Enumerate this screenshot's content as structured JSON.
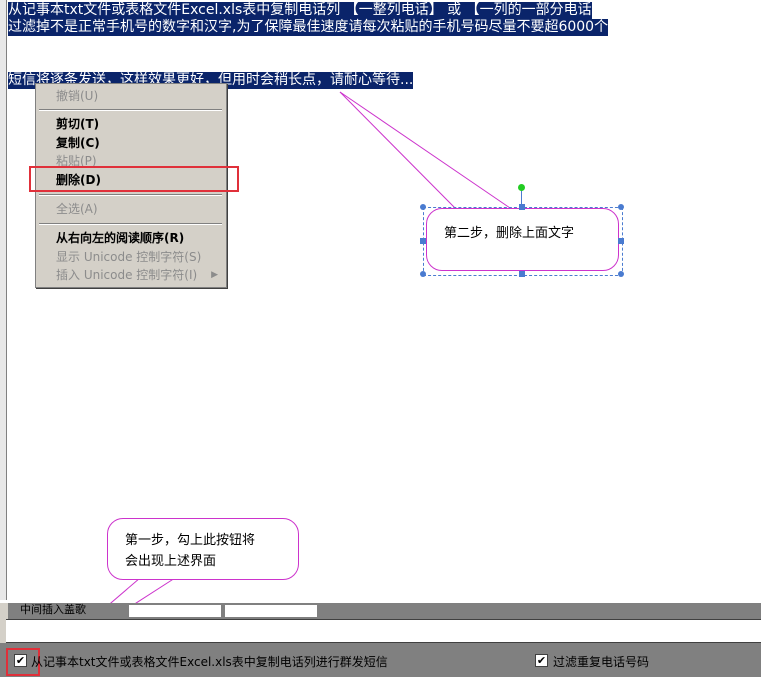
{
  "editor": {
    "line1": "从记事本txt文件或表格文件Excel.xls表中复制电话列 【一整列电话】 或 【一列的一部分电话",
    "line2": "过滤掉不是正常手机号的数字和汉字,为了保障最佳速度请每次粘贴的手机号码尽量不要超6000个",
    "line3": "短信将逐条发送，这样效果更好，但用时会稍长点，请耐心等待..."
  },
  "context_menu": {
    "undo": "撤销(U)",
    "cut": "剪切(T)",
    "copy": "复制(C)",
    "paste": "粘贴(P)",
    "delete": "删除(D)",
    "select_all": "全选(A)",
    "rtl": "从右向左的阅读顺序(R)",
    "show_unicode": "显示 Unicode 控制字符(S)",
    "insert_unicode": "插入 Unicode 控制字符(I)"
  },
  "callouts": {
    "step2": "第二步，删除上面文字",
    "step1_line1": "第一步，勾上此按钮将",
    "step1_line2": "会出现上述界面"
  },
  "partial_label": "中间插入盖歌",
  "bottom": {
    "copy_checkbox_label": "从记事本txt文件或表格文件Excel.xls表中复制电话列进行群发短信",
    "copy_checkbox_checked": true,
    "filter_checkbox_label": "过滤重复电话号码",
    "filter_checkbox_checked": true
  },
  "colors": {
    "selection": "#0a246a",
    "highlight": "#e0303a",
    "callout_border": "#cc33cc",
    "handle": "#4a7bd0",
    "rotate_handle": "#22cc22"
  }
}
